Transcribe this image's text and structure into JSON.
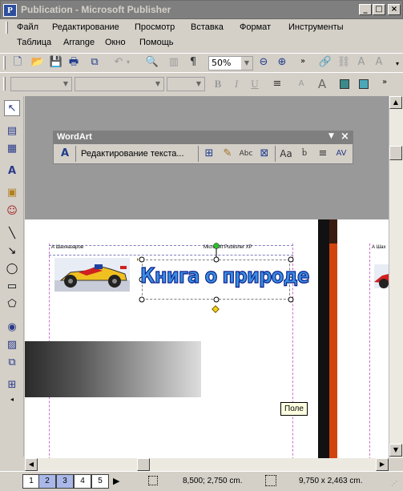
{
  "window": {
    "title": "Publication - Microsoft Publisher",
    "icon": "publisher-app-icon"
  },
  "menu": {
    "row1": [
      "Файл",
      "Редактирование",
      "Просмотр",
      "Вставка",
      "Формат",
      "Инструменты"
    ],
    "row2": [
      "Таблица",
      "Arrange",
      "Окно",
      "Помощь"
    ]
  },
  "standard_toolbar": {
    "zoom": "50%"
  },
  "wordart_toolbar": {
    "title": "WordArt",
    "edit_text_label": "Редактирование текста..."
  },
  "document": {
    "header_left": "А Шахназаров",
    "header_right": "Microsoft Publisher XP",
    "header_left_2": "А Шах",
    "wordart_text": "Книга о природе"
  },
  "tooltip": "Поле",
  "status": {
    "pages": [
      "1",
      "2",
      "3",
      "4",
      "5"
    ],
    "selected_pages": [
      "2",
      "3"
    ],
    "position": "8,500; 2,750 cm.",
    "size": "9,750 x 2,463 cm."
  },
  "colors": {
    "wordart_fill": "#3a8fe0",
    "wordart_outline": "#0a1f8c",
    "page_stripe": "#d2440f"
  }
}
